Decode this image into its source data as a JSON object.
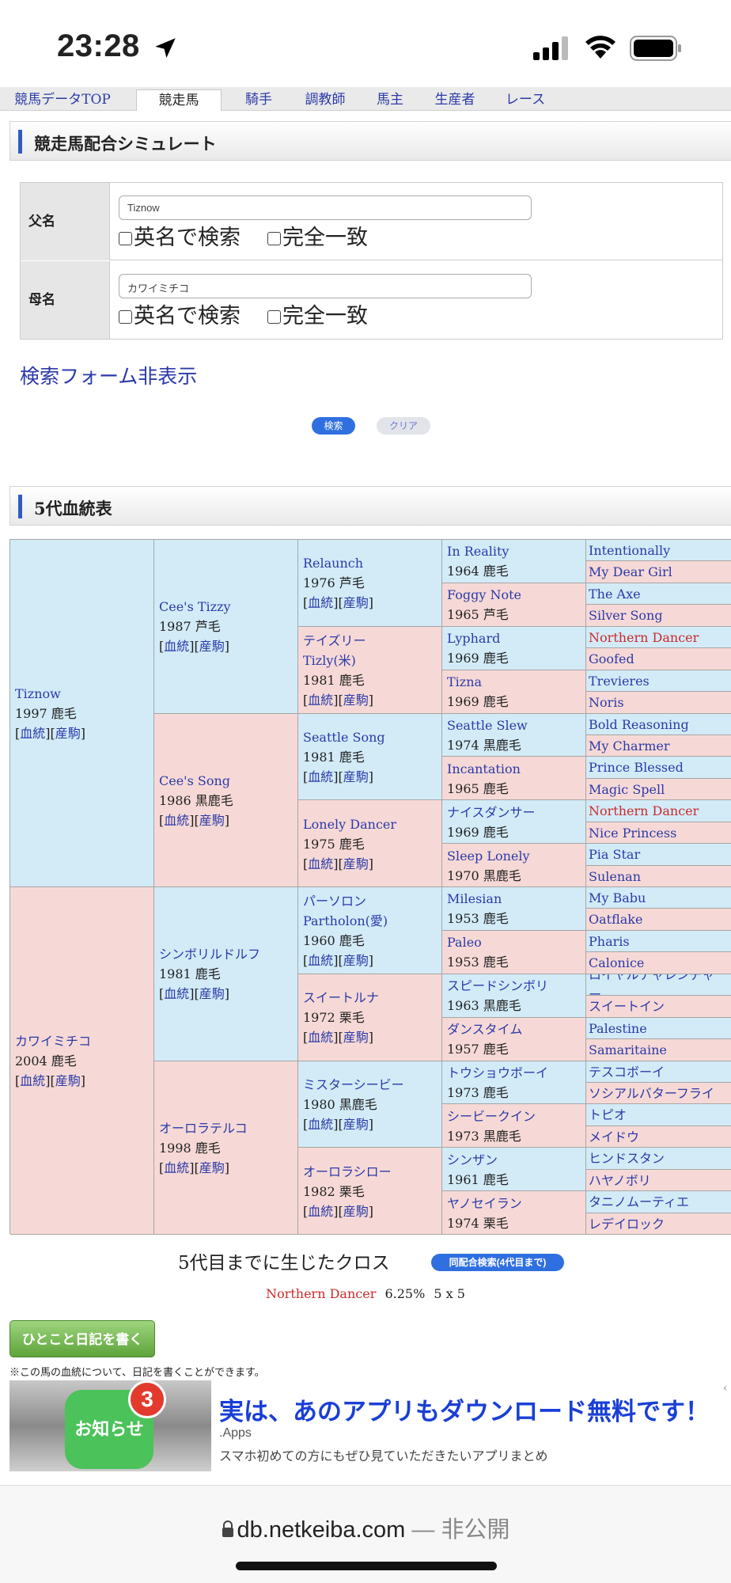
{
  "status_bar": {
    "time": "23:28"
  },
  "nav": {
    "tabs": [
      "競馬データTOP",
      "競走馬",
      "騎手",
      "調教師",
      "馬主",
      "生産者",
      "レース"
    ],
    "active": "競走馬"
  },
  "simulate": {
    "title": "競走馬配合シミュレート",
    "sire_label": "父名",
    "sire_value": "Tiznow",
    "dam_label": "母名",
    "dam_value": "カワイミチコ",
    "opt_english": "英名で検索",
    "opt_exact": "完全一致",
    "toggle_link": "検索フォーム非表示",
    "search_button": "検索",
    "clear_button": "クリア"
  },
  "pedigree": {
    "title": "5代血統表",
    "link_blood": "血統",
    "link_offspring": "産駒",
    "g1": [
      {
        "name": "Tiznow",
        "info": "1997 鹿毛"
      },
      {
        "name": "カワイミチコ",
        "info": "2004 鹿毛"
      }
    ],
    "g2": [
      {
        "name": "Cee's Tizzy",
        "info": "1987 芦毛"
      },
      {
        "name": "Cee's Song",
        "info": "1986 黒鹿毛"
      },
      {
        "name": "シンボリルドルフ",
        "info": "1981 鹿毛"
      },
      {
        "name": "オーロラテルコ",
        "info": "1998 鹿毛"
      }
    ],
    "g3": [
      {
        "name": "Relaunch",
        "name2": "",
        "info": "1976 芦毛"
      },
      {
        "name": "テイズリー",
        "name2": "Tizly(米)",
        "info": "1981 鹿毛"
      },
      {
        "name": "Seattle Song",
        "name2": "",
        "info": "1981 鹿毛"
      },
      {
        "name": "Lonely Dancer",
        "name2": "",
        "info": "1975 鹿毛"
      },
      {
        "name": "パーソロン",
        "name2": "Partholon(愛)",
        "info": "1960 鹿毛"
      },
      {
        "name": "スイートルナ",
        "name2": "",
        "info": "1972 栗毛"
      },
      {
        "name": "ミスターシービー",
        "name2": "",
        "info": "1980 黒鹿毛"
      },
      {
        "name": "オーロラシロー",
        "name2": "",
        "info": "1982 栗毛"
      }
    ],
    "g4": [
      {
        "name": "In Reality",
        "info": "1964 鹿毛"
      },
      {
        "name": "Foggy Note",
        "info": "1965 芦毛"
      },
      {
        "name": "Lyphard",
        "info": "1969 鹿毛"
      },
      {
        "name": "Tizna",
        "info": "1969 鹿毛"
      },
      {
        "name": "Seattle Slew",
        "info": "1974 黒鹿毛"
      },
      {
        "name": "Incantation",
        "info": "1965 鹿毛"
      },
      {
        "name": "ナイスダンサー",
        "info": "1969 鹿毛"
      },
      {
        "name": "Sleep Lonely",
        "info": "1970 黒鹿毛"
      },
      {
        "name": "Milesian",
        "info": "1953 鹿毛"
      },
      {
        "name": "Paleo",
        "info": "1953 鹿毛"
      },
      {
        "name": "スピードシンボリ",
        "info": "1963 黒鹿毛"
      },
      {
        "name": "ダンスタイム",
        "info": "1957 鹿毛"
      },
      {
        "name": "トウショウボーイ",
        "info": "1973 鹿毛"
      },
      {
        "name": "シービークイン",
        "info": "1973 黒鹿毛"
      },
      {
        "name": "シンザン",
        "info": "1961 鹿毛"
      },
      {
        "name": "ヤノセイラン",
        "info": "1974 栗毛"
      }
    ],
    "g5": [
      {
        "name": "Intentionally",
        "line2": "",
        "cross": false
      },
      {
        "name": "My Dear Girl",
        "line2": "",
        "cross": false
      },
      {
        "name": "The Axe",
        "line2": "",
        "cross": false
      },
      {
        "name": "Silver Song",
        "line2": "",
        "cross": false
      },
      {
        "name": "Northern Dancer",
        "line2": "",
        "cross": true
      },
      {
        "name": "Goofed",
        "line2": "",
        "cross": false
      },
      {
        "name": "Trevieres",
        "line2": "",
        "cross": false
      },
      {
        "name": "Noris",
        "line2": "",
        "cross": false
      },
      {
        "name": "Bold Reasoning",
        "line2": "",
        "cross": false
      },
      {
        "name": "My Charmer",
        "line2": "",
        "cross": false
      },
      {
        "name": "Prince Blessed",
        "line2": "",
        "cross": false
      },
      {
        "name": "Magic Spell",
        "line2": "",
        "cross": false
      },
      {
        "name": "Northern Dancer",
        "line2": "",
        "cross": true
      },
      {
        "name": "Nice Princess",
        "line2": "",
        "cross": false
      },
      {
        "name": "Pia Star",
        "line2": "",
        "cross": false
      },
      {
        "name": "Sulenan",
        "line2": "",
        "cross": false
      },
      {
        "name": "My Babu",
        "line2": "",
        "cross": false
      },
      {
        "name": "Oatflake",
        "line2": "",
        "cross": false
      },
      {
        "name": "Pharis",
        "line2": "",
        "cross": false
      },
      {
        "name": "Calonice",
        "line2": "",
        "cross": false
      },
      {
        "name": "ロイヤルチャレンヂャ",
        "line2": "ー",
        "cross": false
      },
      {
        "name": "スイートイン",
        "line2": "",
        "cross": false
      },
      {
        "name": "Palestine",
        "line2": "",
        "cross": false
      },
      {
        "name": "Samaritaine",
        "line2": "",
        "cross": false
      },
      {
        "name": "テスコボーイ",
        "line2": "",
        "cross": false
      },
      {
        "name": "ソシアルバターフライ",
        "line2": "",
        "cross": false
      },
      {
        "name": "トピオ",
        "line2": "",
        "cross": false
      },
      {
        "name": "メイドウ",
        "line2": "",
        "cross": false
      },
      {
        "name": "ヒンドスタン",
        "line2": "",
        "cross": false
      },
      {
        "name": "ハヤノボリ",
        "line2": "",
        "cross": false
      },
      {
        "name": "タニノムーティエ",
        "line2": "",
        "cross": false
      },
      {
        "name": "レデイロック",
        "line2": "",
        "cross": false
      }
    ]
  },
  "cross": {
    "title": "5代目までに生じたクロス",
    "button": "同配合検索(4代目まで)",
    "horse": "Northern Dancer",
    "percent": "6.25%",
    "pattern": "5 x 5"
  },
  "diary": {
    "button": "ひとこと日記を書く",
    "note": "※この馬の血統について、日記を書くことができます。"
  },
  "ad": {
    "icon_text": "お知らせ",
    "badge": "3",
    "title": "実は、あのアプリもダウンロード無料です！",
    "source": ".Apps",
    "desc": "スマホ初めての方にもぜひ見ていただきたいアプリまとめ"
  },
  "browser": {
    "domain": "db.netkeiba.com",
    "privacy": "— 非公開"
  },
  "colors": {
    "male_bg": "#d2ebf7",
    "female_bg": "#f6d9d6",
    "link": "#2b3aa8",
    "cross_red": "#cc2a2a"
  }
}
